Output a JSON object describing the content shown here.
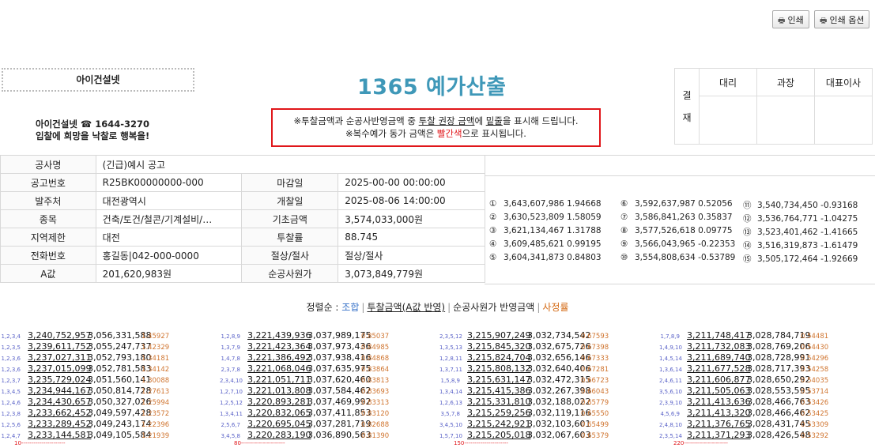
{
  "toolbar": {
    "print_label": "인쇄",
    "print_options_label": "인쇄 옵션",
    "icon": "printer-icon"
  },
  "header": {
    "logo_text": "아이건설넷",
    "title": "1365 예가산출",
    "notice_line1_pre": "※투찰금액과 순공사반영금액 중 ",
    "notice_line1_u": "투찰 권장 금액",
    "notice_line1_mid": "에 ",
    "notice_line1_u2": "밑줄",
    "notice_line1_post": "을 표시해 드립니다.",
    "notice_line2_pre": "※복수예가 동가 금액은 ",
    "notice_line2_red": "빨간색",
    "notice_line2_post": "으로 표시됩니다.",
    "company_line1": "아이건설넷 ☎ 1644-3270",
    "company_line2": "입찰에 희망을 낙찰로 행복을!"
  },
  "approval": {
    "side": [
      "결",
      "재"
    ],
    "cols": [
      "대리",
      "과장",
      "대표이사"
    ]
  },
  "info": {
    "rows": [
      [
        "공사명",
        "(긴급)예시 공고",
        "",
        ""
      ],
      [
        "공고번호",
        "R25BK00000000-000",
        "마감일",
        "2025-00-00 00:00:00"
      ],
      [
        "발주처",
        "대전광역시",
        "개찰일",
        "2025-08-06 14:00:00"
      ],
      [
        "종목",
        "건축/토건/철콘/기계설비/…",
        "기초금액",
        "3,574,033,000원"
      ],
      [
        "지역제한",
        "대전",
        "투찰률",
        "88.745"
      ],
      [
        "전화번호",
        "홍길동|042-000-0000",
        "절상/절사",
        "절상/절사"
      ],
      [
        "A값",
        "201,620,983원",
        "순공사원가",
        "3,073,849,779원"
      ]
    ]
  },
  "multiples": [
    {
      "n": "①",
      "v": "3,643,607,986",
      "p": "1.94668"
    },
    {
      "n": "②",
      "v": "3,630,523,809",
      "p": "1.58059"
    },
    {
      "n": "③",
      "v": "3,621,134,467",
      "p": "1.31788"
    },
    {
      "n": "④",
      "v": "3,609,485,621",
      "p": "0.99195"
    },
    {
      "n": "⑤",
      "v": "3,604,341,873",
      "p": "0.84803"
    },
    {
      "n": "⑥",
      "v": "3,592,637,987",
      "p": "0.52056"
    },
    {
      "n": "⑦",
      "v": "3,586,841,263",
      "p": "0.35837"
    },
    {
      "n": "⑧",
      "v": "3,577,526,618",
      "p": "0.09775"
    },
    {
      "n": "⑨",
      "v": "3,566,043,965",
      "p": "-0.22353"
    },
    {
      "n": "⑩",
      "v": "3,554,808,634",
      "p": "-0.53789"
    },
    {
      "n": "⑪",
      "v": "3,540,734,450",
      "p": "-0.93168"
    },
    {
      "n": "⑫",
      "v": "3,536,764,771",
      "p": "-1.04275"
    },
    {
      "n": "⑬",
      "v": "3,523,401,462",
      "p": "-1.41665"
    },
    {
      "n": "⑭",
      "v": "3,516,319,873",
      "p": "-1.61479"
    },
    {
      "n": "⑮",
      "v": "3,505,172,464",
      "p": "-1.92669"
    }
  ],
  "sort": {
    "label": "정렬순 :",
    "options": [
      "조합",
      "투찰금액(A값 반영)",
      "순공사원가 반영금액",
      "사정률"
    ]
  },
  "results": [
    {
      "footer": "10----------------------",
      "rows": [
        [
          "1,2,3,4",
          "3,240,752,957",
          "3,056,331,588",
          "1.45927"
        ],
        [
          "1,2,3,5",
          "3,239,611,752",
          "3,055,247,737",
          "1.42329"
        ],
        [
          "1,2,3,6",
          "3,237,027,311",
          "3,052,793,180",
          "1.34181"
        ],
        [
          "1,2,3,6",
          "3,237,015,099",
          "3,052,781,583",
          "1.34142"
        ],
        [
          "1,2,3,7",
          "3,235,729,024",
          "3,051,560,141",
          "1.30088"
        ],
        [
          "1,3,4,5",
          "3,234,944,167",
          "3,050,814,728",
          "1.27613"
        ],
        [
          "1,2,4,6",
          "3,234,430,657",
          "3,050,327,026",
          "1.25994"
        ],
        [
          "1,2,3,8",
          "3,233,662,452",
          "3,049,597,428",
          "1.23572"
        ],
        [
          "1,2,5,6",
          "3,233,289,452",
          "3,049,243,174",
          "1.22396"
        ],
        [
          "1,2,4,7",
          "3,233,144,581",
          "3,049,105,584",
          "1.21939"
        ]
      ]
    },
    {
      "footer": "80----------------------",
      "rows": [
        [
          "1,2,8,9",
          "3,221,439,936",
          "3,037,989,175",
          "0.85037"
        ],
        [
          "1,3,7,9",
          "3,221,423,364",
          "3,037,973,436",
          "0.84985"
        ],
        [
          "1,4,7,8",
          "3,221,386,492",
          "3,037,938,416",
          "0.84868"
        ],
        [
          "2,3,7,8",
          "3,221,068,046",
          "3,037,635,975",
          "0.83864"
        ],
        [
          "2,3,4,10",
          "3,221,051,711",
          "3,037,620,460",
          "0.83813"
        ],
        [
          "1,2,7,10",
          "3,221,013,808",
          "3,037,584,462",
          "0.83693"
        ],
        [
          "1,2,5,12",
          "3,220,893,281",
          "3,037,469,992",
          "0.83313"
        ],
        [
          "1,3,4,11",
          "3,220,832,065",
          "3,037,411,853",
          "0.83120"
        ],
        [
          "2,5,6,7",
          "3,220,695,045",
          "3,037,281,719",
          "0.82688"
        ],
        [
          "3,4,5,8",
          "3,220,283,190",
          "3,036,890,563",
          "0.81390"
        ]
      ]
    },
    {
      "footer": "150----------------------",
      "rows": [
        [
          "2,3,5,12",
          "3,215,907,249",
          "3,032,734,542",
          "0.67593"
        ],
        [
          "1,3,5,13",
          "3,215,845,320",
          "3,032,675,726",
          "0.67398"
        ],
        [
          "1,2,8,11",
          "3,215,824,704",
          "3,032,656,146",
          "0.67333"
        ],
        [
          "1,3,7,11",
          "3,215,808,132",
          "3,032,640,406",
          "0.67281"
        ],
        [
          "1,5,8,9",
          "3,215,631,147",
          "3,032,472,315",
          "0.66723"
        ],
        [
          "1,3,4,14",
          "3,215,415,386",
          "3,032,267,398",
          "0.66043"
        ],
        [
          "1,2,6,13",
          "3,215,331,810",
          "3,032,188,022",
          "0.65779"
        ],
        [
          "3,5,7,8",
          "3,215,259,256",
          "3,032,119,116",
          "0.65550"
        ],
        [
          "3,4,5,10",
          "3,215,242,921",
          "3,032,103,601",
          "0.65499"
        ],
        [
          "1,5,7,10",
          "3,215,205,018",
          "3,032,067,603",
          "0.65379"
        ]
      ]
    },
    {
      "footer": "220----------------------",
      "rows": [
        [
          "1,7,8,9",
          "3,211,748,417",
          "3,028,784,719",
          "0.54481"
        ],
        [
          "1,4,9,10",
          "3,211,732,083",
          "3,028,769,206",
          "0.54430"
        ],
        [
          "1,4,5,14",
          "3,211,689,740",
          "3,028,728,991",
          "0.54296"
        ],
        [
          "1,3,6,14",
          "3,211,677,528",
          "3,028,717,393",
          "0.54258"
        ],
        [
          "2,4,6,11",
          "3,211,606,877",
          "3,028,650,292",
          "0.54035"
        ],
        [
          "3,5,6,10",
          "3,211,505,063",
          "3,028,553,595",
          "0.53714"
        ],
        [
          "2,3,9,10",
          "3,211,413,636",
          "3,028,466,763",
          "0.53426"
        ],
        [
          "4,5,6,9",
          "3,211,413,320",
          "3,028,466,462",
          "0.53425"
        ],
        [
          "2,4,8,10",
          "3,211,376,765",
          "3,028,431,745",
          "0.53309"
        ],
        [
          "2,3,5,14",
          "3,211,371,293",
          "3,028,426,548",
          "0.53292"
        ]
      ]
    }
  ]
}
